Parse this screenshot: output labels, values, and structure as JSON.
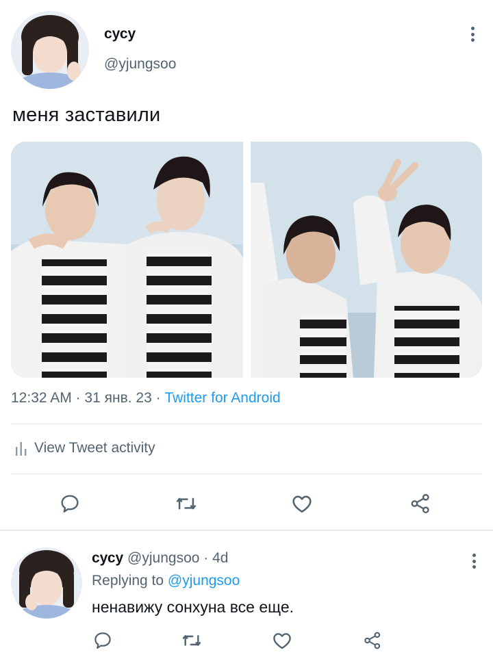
{
  "tweet": {
    "author": {
      "display_name": "сусу",
      "handle": "@yjungsoo"
    },
    "text": "меня заставили",
    "time": "12:32 AM",
    "date": "31 янв. 23",
    "source": "Twitter for Android",
    "activity_label": "View Tweet activity",
    "actions": [
      "reply-icon",
      "retweet-icon",
      "like-icon",
      "share-icon"
    ]
  },
  "reply": {
    "author": {
      "display_name": "сусу",
      "handle": "@yjungsoo"
    },
    "age": "4d",
    "replying_prefix": "Replying to",
    "replying_to": "@yjungsoo",
    "text": "ненавижу сонхуна все еще."
  },
  "colors": {
    "link": "#1d9bf0",
    "secondary": "#536471",
    "primary_text": "#0f1419"
  }
}
